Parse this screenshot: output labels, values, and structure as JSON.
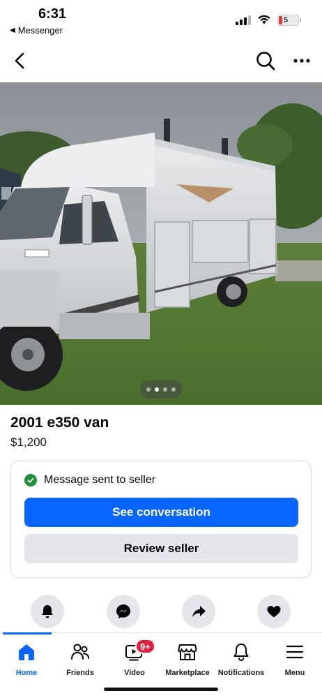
{
  "status_bar": {
    "time": "6:31",
    "back_app": "Messenger",
    "battery": "5"
  },
  "nav": {
    "back_icon": "chevron-left-icon",
    "search_icon": "search-icon",
    "more_icon": "more-horizontal-icon"
  },
  "carousel": {
    "image_count": 4,
    "current_index": 1
  },
  "listing": {
    "title": "2001 e350 van",
    "price": "$1,200"
  },
  "message_card": {
    "status": "Message sent to seller",
    "primary_button": "See conversation",
    "secondary_button": "Review seller"
  },
  "actions": [
    {
      "icon": "bell-icon"
    },
    {
      "icon": "messenger-icon"
    },
    {
      "icon": "share-icon"
    },
    {
      "icon": "heart-icon"
    }
  ],
  "tabs": [
    {
      "label": "Home",
      "icon": "home-icon",
      "active": true
    },
    {
      "label": "Friends",
      "icon": "friends-icon"
    },
    {
      "label": "Video",
      "icon": "video-icon",
      "badge": "9+"
    },
    {
      "label": "Marketplace",
      "icon": "marketplace-icon"
    },
    {
      "label": "Notifications",
      "icon": "bell-icon"
    },
    {
      "label": "Menu",
      "icon": "menu-icon"
    }
  ],
  "colors": {
    "accent": "#0866ff",
    "success": "#1f8f3a",
    "badge": "#e41e3f"
  }
}
